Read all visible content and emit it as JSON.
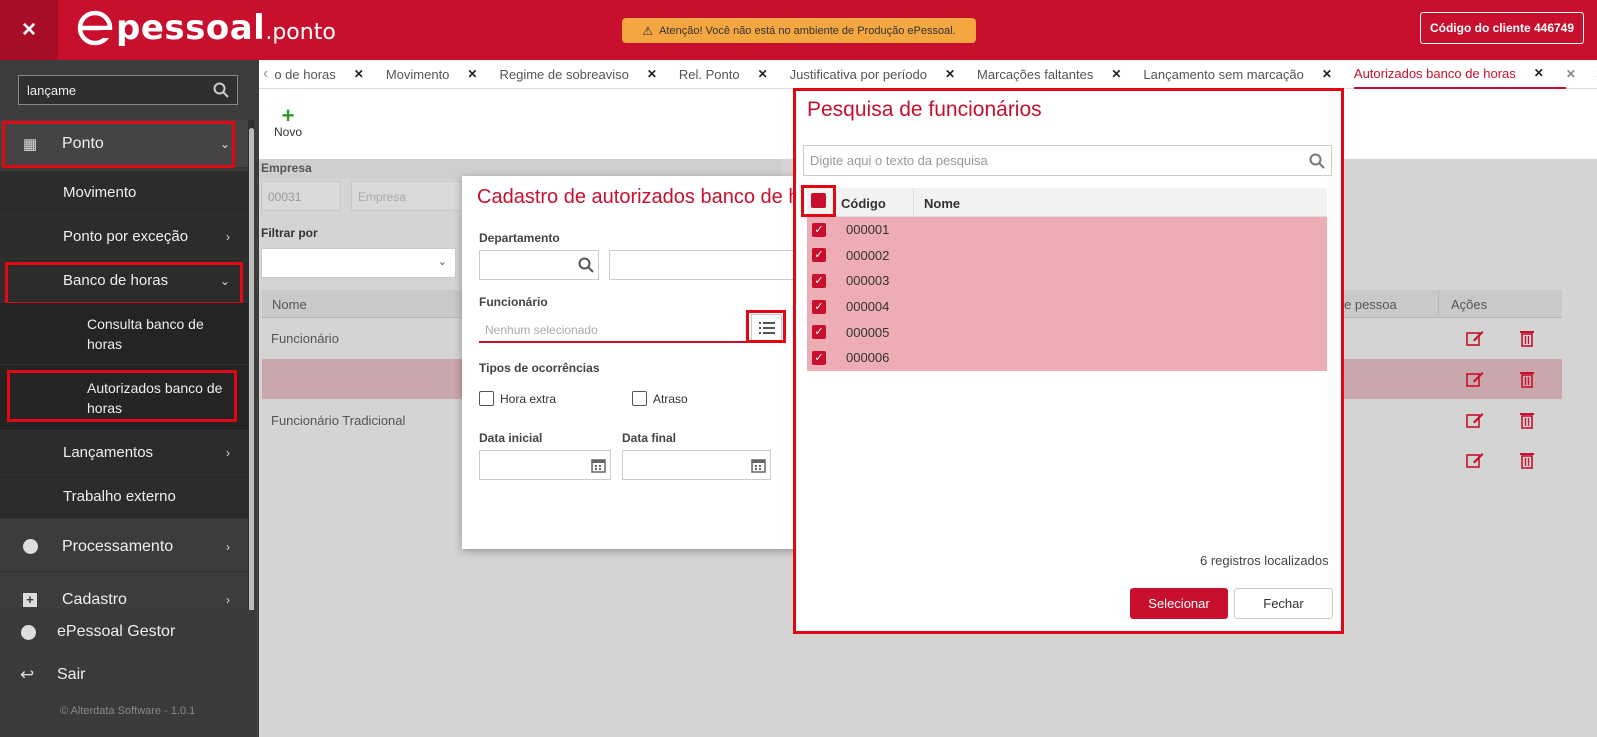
{
  "header": {
    "close_glyph": "×",
    "logo_main": "pessoal",
    "logo_suffix": ".ponto",
    "warning": "Atenção! Você não está no ambiente de Produção ePessoal.",
    "client_button": "Código do cliente 446749"
  },
  "sidebar": {
    "search_value": "lançame",
    "items": [
      {
        "label": "Ponto"
      },
      {
        "label": "Movimento"
      },
      {
        "label": "Ponto por exceção"
      },
      {
        "label": "Banco de horas"
      },
      {
        "label": "Consulta banco de horas"
      },
      {
        "label": "Autorizados banco de horas"
      },
      {
        "label": "Lançamentos"
      },
      {
        "label": "Trabalho externo"
      },
      {
        "label": "Processamento"
      },
      {
        "label": "Cadastro"
      },
      {
        "label": "ePessoal Gestor"
      },
      {
        "label": "Sair"
      }
    ],
    "footer": "© Alterdata Software - 1.0.1"
  },
  "tabs": [
    {
      "label": "o de horas"
    },
    {
      "label": "Movimento"
    },
    {
      "label": "Regime de sobreaviso"
    },
    {
      "label": "Rel. Ponto"
    },
    {
      "label": "Justificativa por período"
    },
    {
      "label": "Marcações faltantes"
    },
    {
      "label": "Lançamento sem marcação"
    },
    {
      "label": "Autorizados banco de horas"
    }
  ],
  "main": {
    "novo_label": "Novo",
    "empresa_label": "Empresa",
    "empresa_code": "00031",
    "empresa_placeholder": "Empresa",
    "filtrar_label": "Filtrar por",
    "table_headers": {
      "nome": "Nome",
      "pessoa": "e pessoa",
      "acoes": "Ações"
    },
    "rows": [
      "Funcionário",
      "",
      "Funcionário Tradicional",
      ""
    ]
  },
  "cadastro": {
    "title": "Cadastro de autorizados banco de horas",
    "departamento_label": "Departamento",
    "funcionario_label": "Funcionário",
    "funcionario_placeholder": "Nenhum selecionado",
    "tipos_label": "Tipos de ocorrências",
    "hora_extra": "Hora extra",
    "atraso": "Atraso",
    "data_inicial_label": "Data inicial",
    "data_final_label": "Data final"
  },
  "pesquisa": {
    "title": "Pesquisa de funcionários",
    "search_placeholder": "Digite aqui o texto da pesquisa",
    "col_codigo": "Código",
    "col_nome": "Nome",
    "rows": [
      "000001",
      "000002",
      "000003",
      "000004",
      "000005",
      "000006"
    ],
    "count": "6 registros localizados",
    "select_button": "Selecionar",
    "close_button": "Fechar"
  },
  "colors": {
    "brand": "#c8102e",
    "sidebar": "#3c3c3c",
    "warning": "#f4a640"
  }
}
